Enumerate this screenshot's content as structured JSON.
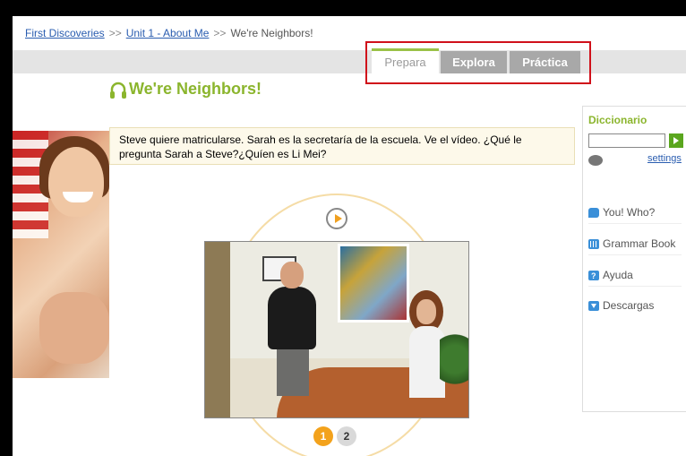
{
  "breadcrumb": {
    "items": [
      "First Discoveries",
      "Unit 1 - About Me",
      "We're Neighbors!"
    ],
    "separator": ">>"
  },
  "tabs": [
    {
      "label": "Prepara"
    },
    {
      "label": "Explora"
    },
    {
      "label": "Práctica"
    }
  ],
  "lesson": {
    "title": "We're Neighbors!",
    "instruction": "Steve quiere matricularse. Sarah es la secretaría de la escuela. Ve el vídeo. ¿Qué le pregunta Sarah a Steve?¿Quíen es Li Mei?"
  },
  "pager": [
    "1",
    "2"
  ],
  "sidebar": {
    "dict_title": "Diccionario",
    "dict_input_value": "",
    "settings_label": "settings",
    "items": [
      {
        "label": "You! Who?",
        "icon": "speech-bubble-icon"
      },
      {
        "label": "Grammar Book",
        "icon": "grammar-book-icon"
      },
      {
        "label": "Ayuda",
        "icon": "help-icon"
      },
      {
        "label": "Descargas",
        "icon": "download-icon"
      }
    ]
  },
  "colors": {
    "accent_green": "#8bb52d",
    "highlight_red": "#d0101a",
    "pager_active": "#f3a21c",
    "link_blue": "#2a5db0"
  }
}
